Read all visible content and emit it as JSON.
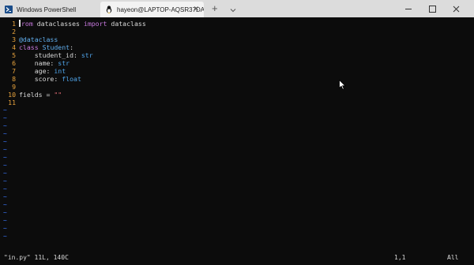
{
  "tabs": [
    {
      "title": "Windows PowerShell",
      "icon": "powershell-icon",
      "active": false
    },
    {
      "title": "hayeon@LAPTOP-AQSR37DA:",
      "icon": "linux-penguin-icon",
      "active": true
    }
  ],
  "titlebar": {
    "new_tab": "+",
    "dropdown_icon": "chevron-down-icon",
    "minimize_icon": "minimize-icon",
    "maximize_icon": "maximize-icon",
    "close_icon": "close-icon"
  },
  "editor": {
    "lines": [
      {
        "num": "1",
        "parts": [
          {
            "t": "rom",
            "c": "kw"
          },
          {
            "t": " dataclasses ",
            "c": ""
          },
          {
            "t": "import",
            "c": "kw"
          },
          {
            "t": " dataclass",
            "c": ""
          }
        ],
        "cursor": true
      },
      {
        "num": "2",
        "parts": []
      },
      {
        "num": "3",
        "parts": [
          {
            "t": "@dataclass",
            "c": "nm"
          }
        ]
      },
      {
        "num": "4",
        "parts": [
          {
            "t": "class",
            "c": "kw"
          },
          {
            "t": " ",
            "c": ""
          },
          {
            "t": "Student",
            "c": "nm"
          },
          {
            "t": ":",
            "c": ""
          }
        ]
      },
      {
        "num": "5",
        "parts": [
          {
            "t": "    student_id: ",
            "c": ""
          },
          {
            "t": "str",
            "c": "ty"
          }
        ]
      },
      {
        "num": "6",
        "parts": [
          {
            "t": "    name: ",
            "c": ""
          },
          {
            "t": "str",
            "c": "ty"
          }
        ]
      },
      {
        "num": "7",
        "parts": [
          {
            "t": "    age: ",
            "c": ""
          },
          {
            "t": "int",
            "c": "ty"
          }
        ]
      },
      {
        "num": "8",
        "parts": [
          {
            "t": "    score: ",
            "c": ""
          },
          {
            "t": "float",
            "c": "ty"
          }
        ]
      },
      {
        "num": "9",
        "parts": []
      },
      {
        "num": "10",
        "parts": [
          {
            "t": "fields = ",
            "c": ""
          },
          {
            "t": "\"\"",
            "c": "st"
          }
        ]
      },
      {
        "num": "11",
        "parts": []
      }
    ],
    "tilde_char": "~",
    "tilde_count": 17
  },
  "statusbar": {
    "file_info": "\"in.py\" 11L, 140C",
    "position": "1,1",
    "scroll": "All"
  },
  "colors": {
    "background": "#0c0c0c",
    "line_number": "#e8a33d",
    "keyword": "#c678dd",
    "type": "#4fa3e8",
    "string": "#e06c75",
    "tilde": "#3b78ff"
  }
}
